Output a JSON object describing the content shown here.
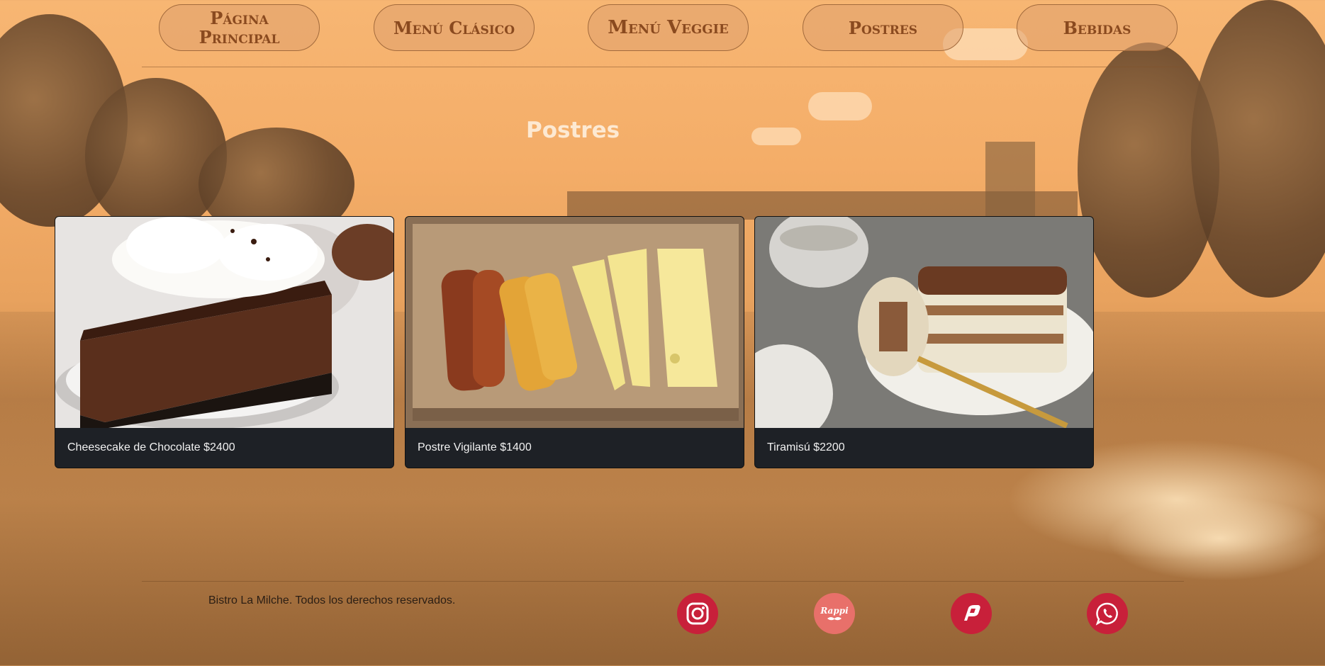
{
  "nav": {
    "items": [
      {
        "label_line1": "Página",
        "label_line2": "Principal"
      },
      {
        "label_line1": "Menú Clásico",
        "label_line2": ""
      },
      {
        "label_line1": "Menú Veggie",
        "label_line2": ""
      },
      {
        "label_line1": "Postres",
        "label_line2": ""
      },
      {
        "label_line1": "Bebidas",
        "label_line2": ""
      }
    ]
  },
  "page_title": "Postres",
  "products": [
    {
      "caption": "Cheesecake de Chocolate $2400",
      "image": "chocolate-cheesecake-photo"
    },
    {
      "caption": "Postre Vigilante $1400",
      "image": "quince-and-cheese-photo"
    },
    {
      "caption": "Tiramisú $2200",
      "image": "tiramisu-photo"
    }
  ],
  "footer": {
    "copyright": "Bistro La Milche. Todos los derechos reservados.",
    "social": [
      {
        "icon": "instagram-icon",
        "color": "#c8203a"
      },
      {
        "icon": "rappi-icon",
        "text": "Rappi",
        "color": "#e8706a"
      },
      {
        "icon": "pedidosya-icon",
        "color": "#c8203a"
      },
      {
        "icon": "whatsapp-icon",
        "color": "#c8203a"
      }
    ]
  }
}
